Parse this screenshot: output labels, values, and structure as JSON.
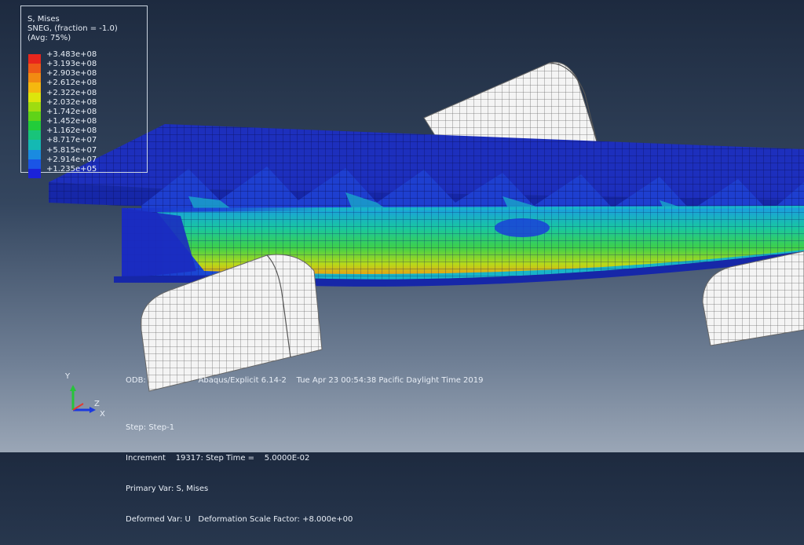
{
  "legend": {
    "title": "S, Mises",
    "subtitle": "SNEG, (fraction = -1.0)",
    "avg": "(Avg: 75%)",
    "values": [
      "+3.483e+08",
      "+3.193e+08",
      "+2.903e+08",
      "+2.612e+08",
      "+2.322e+08",
      "+2.032e+08",
      "+1.742e+08",
      "+1.452e+08",
      "+1.162e+08",
      "+8.717e+07",
      "+5.815e+07",
      "+2.914e+07",
      "+1.235e+05"
    ],
    "colors": [
      "#e8261c",
      "#ee5a17",
      "#f28b12",
      "#f5b80f",
      "#dde50c",
      "#9fdc10",
      "#5fd318",
      "#22cc3a",
      "#18c47a",
      "#14b9b3",
      "#1a8be0",
      "#1a55e6",
      "#1b22d8"
    ]
  },
  "triad": {
    "y_label": "Y",
    "z_label": "Z",
    "x_label": "X"
  },
  "info": {
    "odb": "ODB:",
    "odb_file": "",
    "solver_date": "Abaqus/Explicit 6.14-2    Tue Apr 23 00:54:38 Pacific Daylight Time 2019",
    "step": "Step: Step-1",
    "increment": "Increment    19317: Step Time =    5.0000E-02",
    "primary_var": "Primary Var: S, Mises",
    "deformed_var": "Deformed Var: U   Deformation Scale Factor: +8.000e+00"
  },
  "colors": {
    "plate": "#1c2fb0",
    "plate_edge": "#0f1a80",
    "mesh": "#0a0f50",
    "roller": "#f2f2f2",
    "roller_grid": "#6a6a6a",
    "beam_mid": "#23c85a",
    "beam_hot": "#e8ab12"
  }
}
